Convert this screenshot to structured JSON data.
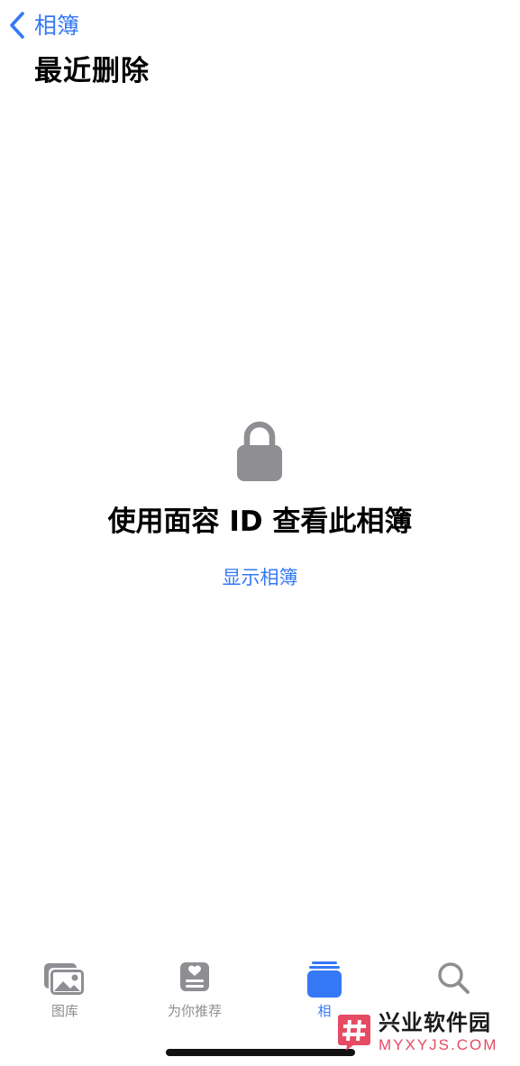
{
  "nav": {
    "back_label": "相簿"
  },
  "page": {
    "title": "最近删除"
  },
  "locked": {
    "message": "使用面容 ID 查看此相簿",
    "action_label": "显示相簿"
  },
  "tab_bar": {
    "tabs": [
      {
        "label": "图库",
        "icon": "photo-library-icon",
        "active": false
      },
      {
        "label": "为你推荐",
        "icon": "for-you-icon",
        "active": false
      },
      {
        "label": "相",
        "icon": "albums-icon",
        "active": true
      },
      {
        "label": "",
        "icon": "search-icon",
        "active": false
      }
    ]
  },
  "watermark": {
    "title": "兴业软件园",
    "url": "MYXYJS.COM"
  },
  "colors": {
    "accent": "#3478f6",
    "inactive": "#8e8e93",
    "lock": "#8e8e93",
    "watermark_brand": "#e64b63"
  }
}
